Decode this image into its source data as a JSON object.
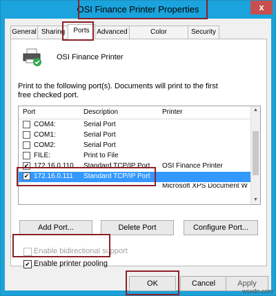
{
  "window": {
    "title": "OSI Finance Printer Properties",
    "close_glyph": "x"
  },
  "tabs": [
    "General",
    "Sharing",
    "Ports",
    "Advanced",
    "Color Management",
    "Security"
  ],
  "printer_name": "OSI Finance Printer",
  "description": "Print to the following port(s). Documents will print to the first free checked port.",
  "columns": {
    "port": "Port",
    "description": "Description",
    "printer": "Printer"
  },
  "ports": [
    {
      "port": "COM4:",
      "description": "Serial Port",
      "printer": "",
      "checked": false
    },
    {
      "port": "COM1:",
      "description": "Serial Port",
      "printer": "",
      "checked": false
    },
    {
      "port": "COM2:",
      "description": "Serial Port",
      "printer": "",
      "checked": false
    },
    {
      "port": "FILE:",
      "description": "Print to File",
      "printer": "",
      "checked": false
    },
    {
      "port": "172.16.0.110",
      "description": "Standard TCP/IP Port",
      "printer": "OSI Finance Printer",
      "checked": true
    },
    {
      "port": "172.16.0.111",
      "description": "Standard TCP/IP Port",
      "printer": "",
      "checked": true,
      "selected": true
    },
    {
      "port": "",
      "description": "",
      "printer": "Microsoft XPS Document W",
      "checked": false
    }
  ],
  "buttons": {
    "add_port": "Add Port...",
    "delete_port": "Delete Port",
    "configure_port": "Configure Port..."
  },
  "options": {
    "bidirectional": "Enable bidirectional support",
    "pooling": "Enable printer pooling"
  },
  "dialog_buttons": {
    "ok": "OK",
    "cancel": "Cancel",
    "apply": "Apply"
  },
  "watermark": "wsxdn.com",
  "colors": {
    "title_bar": "#1aa3dc",
    "selection": "#3399ff",
    "highlight_box": "#8b1f27"
  }
}
